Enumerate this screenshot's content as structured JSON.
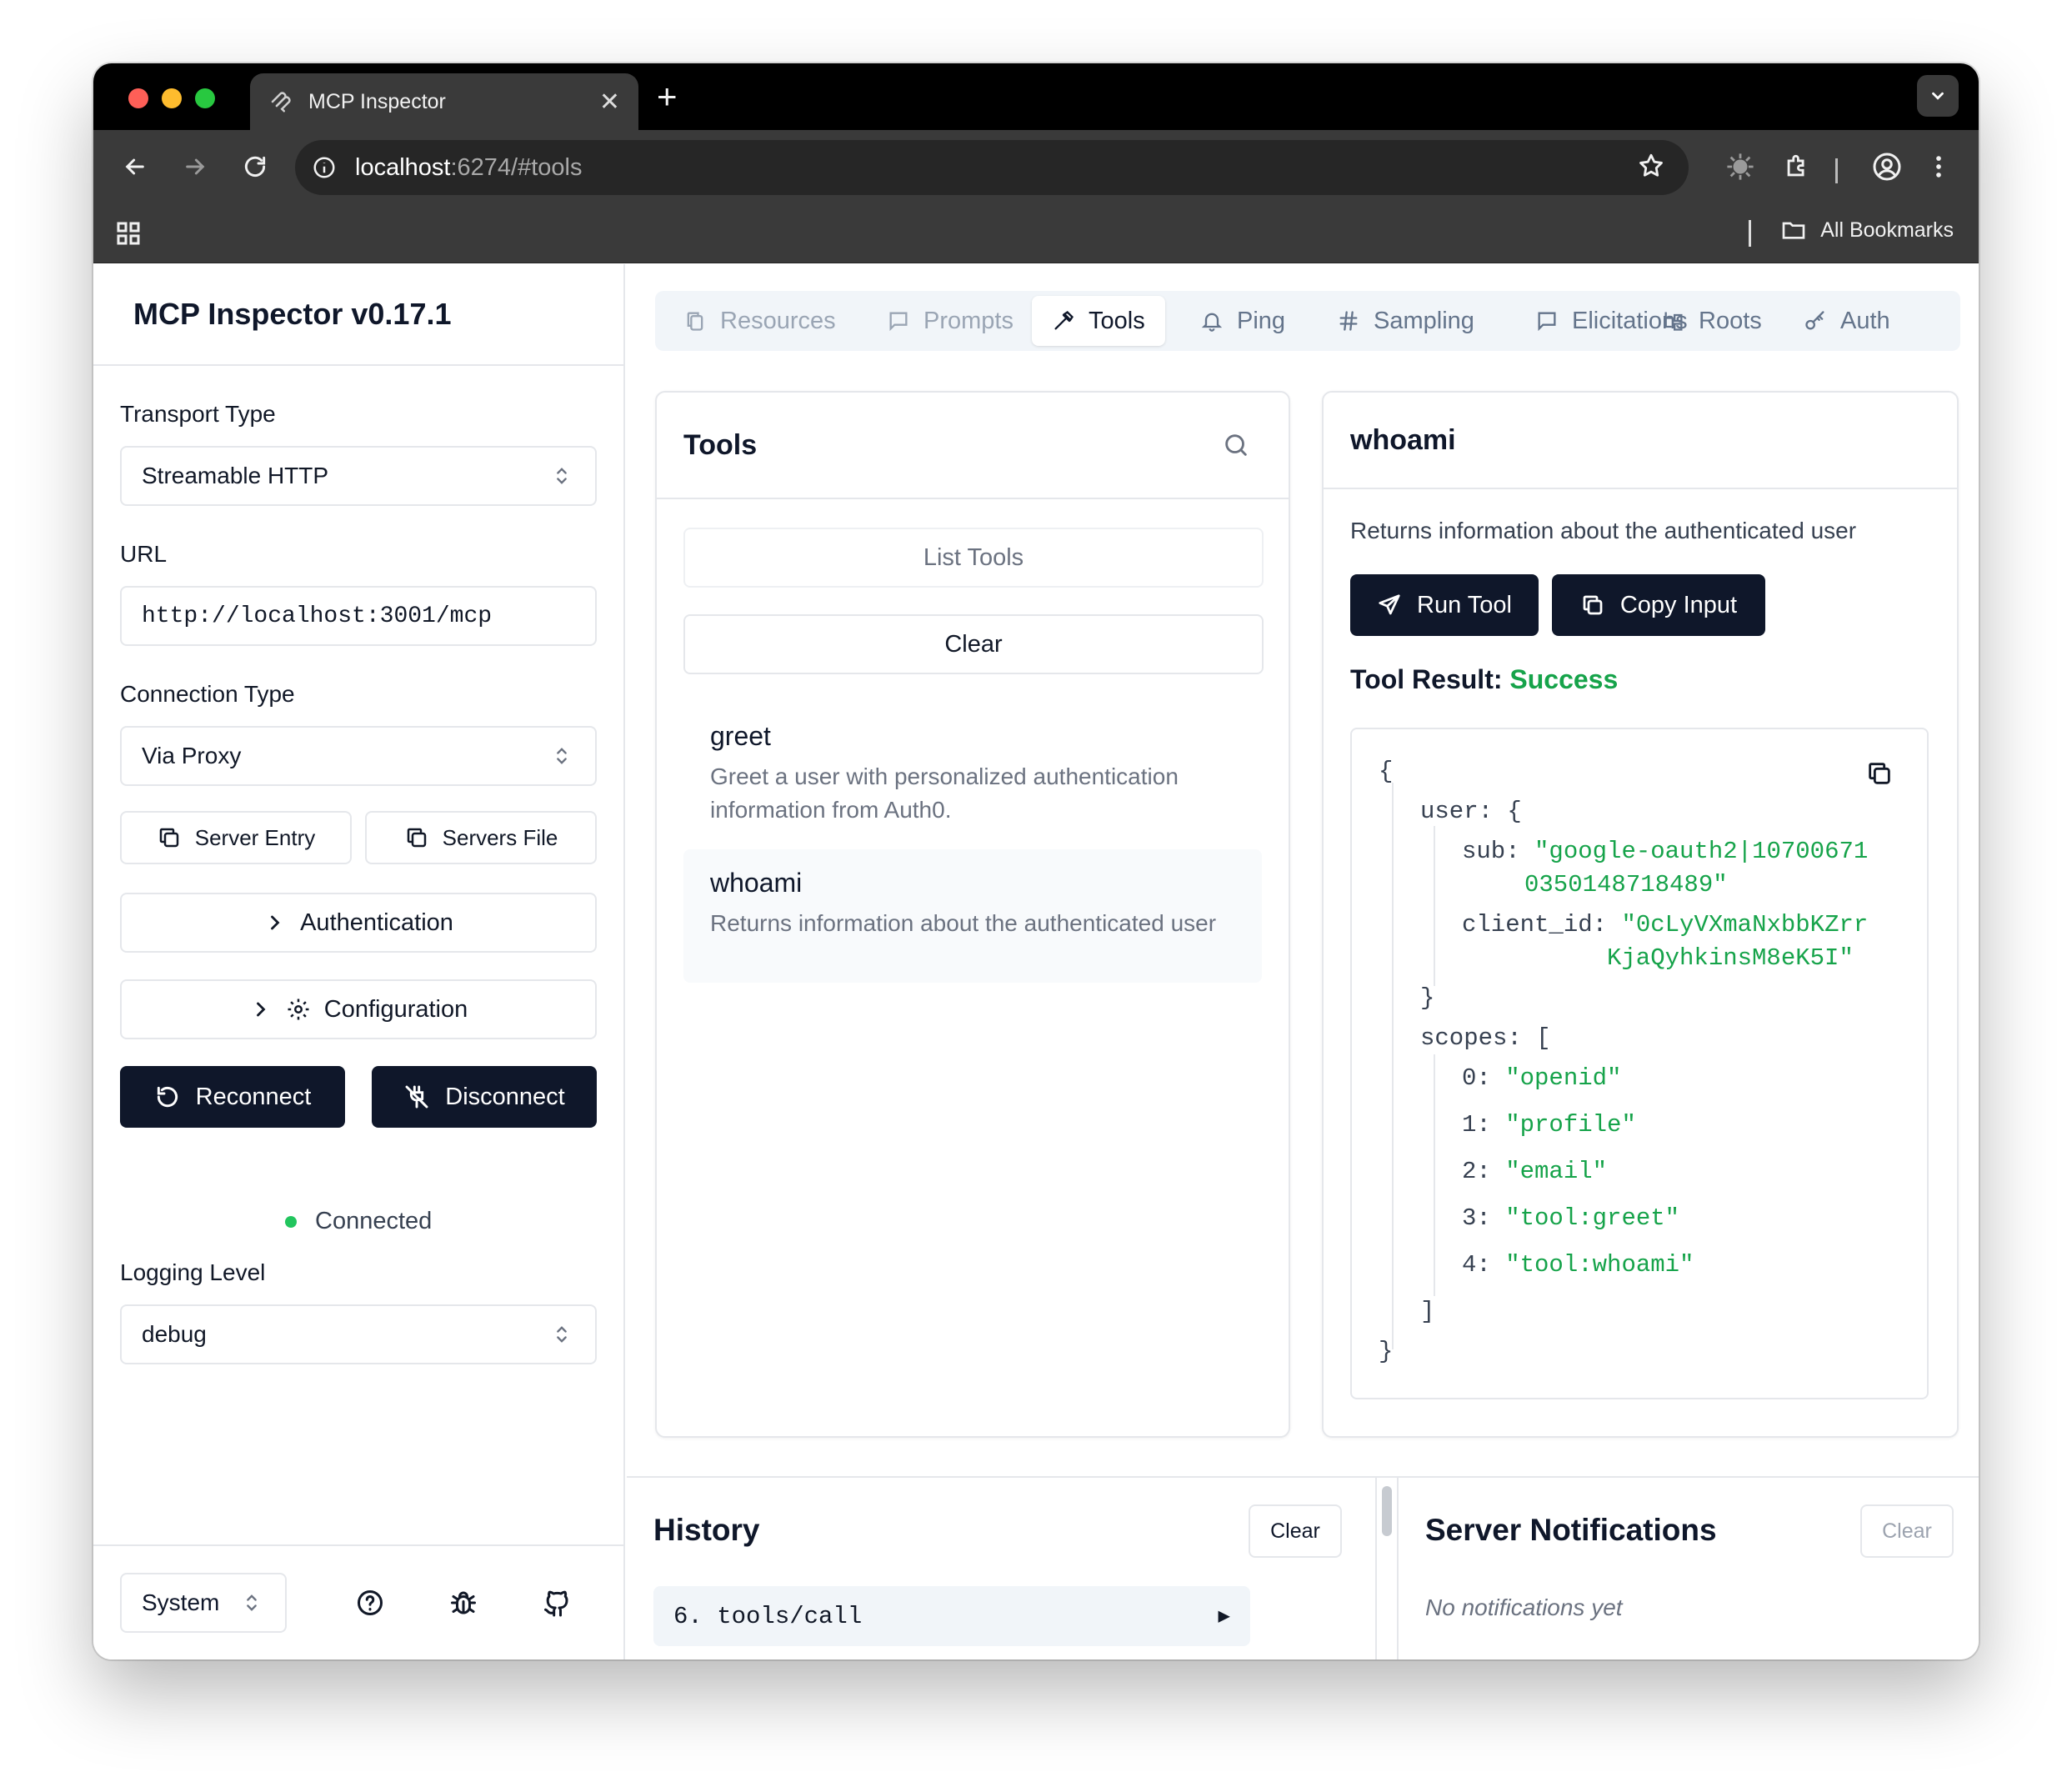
{
  "browser": {
    "tab_title": "MCP Inspector",
    "url_host": "localhost",
    "url_rest": ":6274/#tools",
    "bookmarks_label": "All Bookmarks"
  },
  "sidebar": {
    "title": "MCP Inspector v0.17.1",
    "transport_label": "Transport Type",
    "transport_value": "Streamable HTTP",
    "url_label": "URL",
    "url_value": "http://localhost:3001/mcp",
    "connection_label": "Connection Type",
    "connection_value": "Via Proxy",
    "server_entry": "Server Entry",
    "servers_file": "Servers File",
    "authentication": "Authentication",
    "configuration": "Configuration",
    "reconnect": "Reconnect",
    "disconnect": "Disconnect",
    "status": "Connected",
    "logging_label": "Logging Level",
    "logging_value": "debug",
    "theme_value": "System"
  },
  "tabs": [
    {
      "label": "Resources",
      "icon": "file-icon"
    },
    {
      "label": "Prompts",
      "icon": "message-icon"
    },
    {
      "label": "Tools",
      "icon": "hammer-icon"
    },
    {
      "label": "Ping",
      "icon": "bell-icon"
    },
    {
      "label": "Sampling",
      "icon": "hash-icon"
    },
    {
      "label": "Elicitations",
      "icon": "message-icon"
    },
    {
      "label": "Roots",
      "icon": "folder-tree-icon"
    },
    {
      "label": "Auth",
      "icon": "key-icon"
    }
  ],
  "tools_panel": {
    "title": "Tools",
    "list_tools": "List Tools",
    "clear": "Clear",
    "items": [
      {
        "name": "greet",
        "description": "Greet a user with personalized authentication information from Auth0."
      },
      {
        "name": "whoami",
        "description": "Returns information about the authenticated user"
      }
    ]
  },
  "detail": {
    "title": "whoami",
    "description": "Returns information about the authenticated user",
    "run_tool": "Run Tool",
    "copy_input": "Copy Input",
    "result_label": "Tool Result:",
    "result_status": "Success",
    "result_status_color": "#16a34a",
    "json": {
      "open_brace": "{",
      "user_key": "user:",
      "user_open": "{",
      "sub_key": "sub:",
      "sub_line1": "\"google-oauth2|10700671",
      "sub_line2": "0350148718489\"",
      "client_id_key": "client_id:",
      "client_id_line1": "\"0cLyVXmaNxbbKZrr",
      "client_id_line2": "KjaQyhkinsM8eK5I\"",
      "user_close": "}",
      "scopes_key": "scopes:",
      "scopes_open": "[",
      "scopes": [
        {
          "index": "0:",
          "value": "\"openid\""
        },
        {
          "index": "1:",
          "value": "\"profile\""
        },
        {
          "index": "2:",
          "value": "\"email\""
        },
        {
          "index": "3:",
          "value": "\"tool:greet\""
        },
        {
          "index": "4:",
          "value": "\"tool:whoami\""
        }
      ],
      "scopes_close": "]",
      "close_brace": "}"
    }
  },
  "history": {
    "title": "History",
    "clear": "Clear",
    "entry": "6. tools/call",
    "entry_arrow": "▶"
  },
  "notifications": {
    "title": "Server Notifications",
    "clear": "Clear",
    "empty": "No notifications yet"
  },
  "colors": {
    "primary_dark": "#0f172a",
    "success": "#16a34a",
    "connected_dot": "#22c55e"
  }
}
